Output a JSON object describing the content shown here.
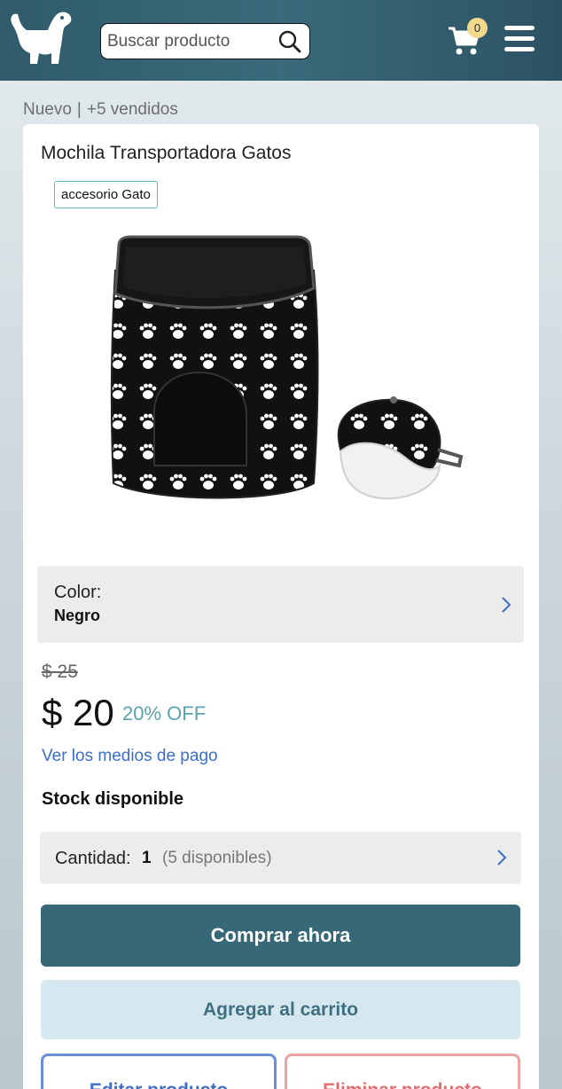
{
  "header": {
    "logo_icon": "dog-logo-icon",
    "search_placeholder": "Buscar producto",
    "search_icon": "search-icon",
    "cart_icon": "cart-icon",
    "cart_count": "0",
    "menu_icon": "hamburger-menu-icon"
  },
  "listing": {
    "condition": "Nuevo",
    "separator": "|",
    "sold": "+5 vendidos"
  },
  "product": {
    "title": "Mochila Transportadora Gatos",
    "tag": "accesorio Gato",
    "color_label": "Color:",
    "color_value": "Negro",
    "old_price": "$ 25",
    "price": "$ 20",
    "discount": "20% OFF",
    "payment_link": "Ver los medios de pago",
    "stock": "Stock disponible",
    "quantity_label": "Cantidad:",
    "quantity_value": "1",
    "quantity_available": "(5 disponibles)"
  },
  "actions": {
    "buy": "Comprar ahora",
    "add_to_cart": "Agregar al carrito",
    "edit": "Editar producto",
    "delete": "Eliminar producto"
  },
  "colors": {
    "header": "#366877",
    "primary_button": "#366877",
    "secondary_button": "#d6e8ef",
    "link": "#3b6fc8",
    "discount": "#5aa3ad",
    "danger": "#e06d6d"
  }
}
